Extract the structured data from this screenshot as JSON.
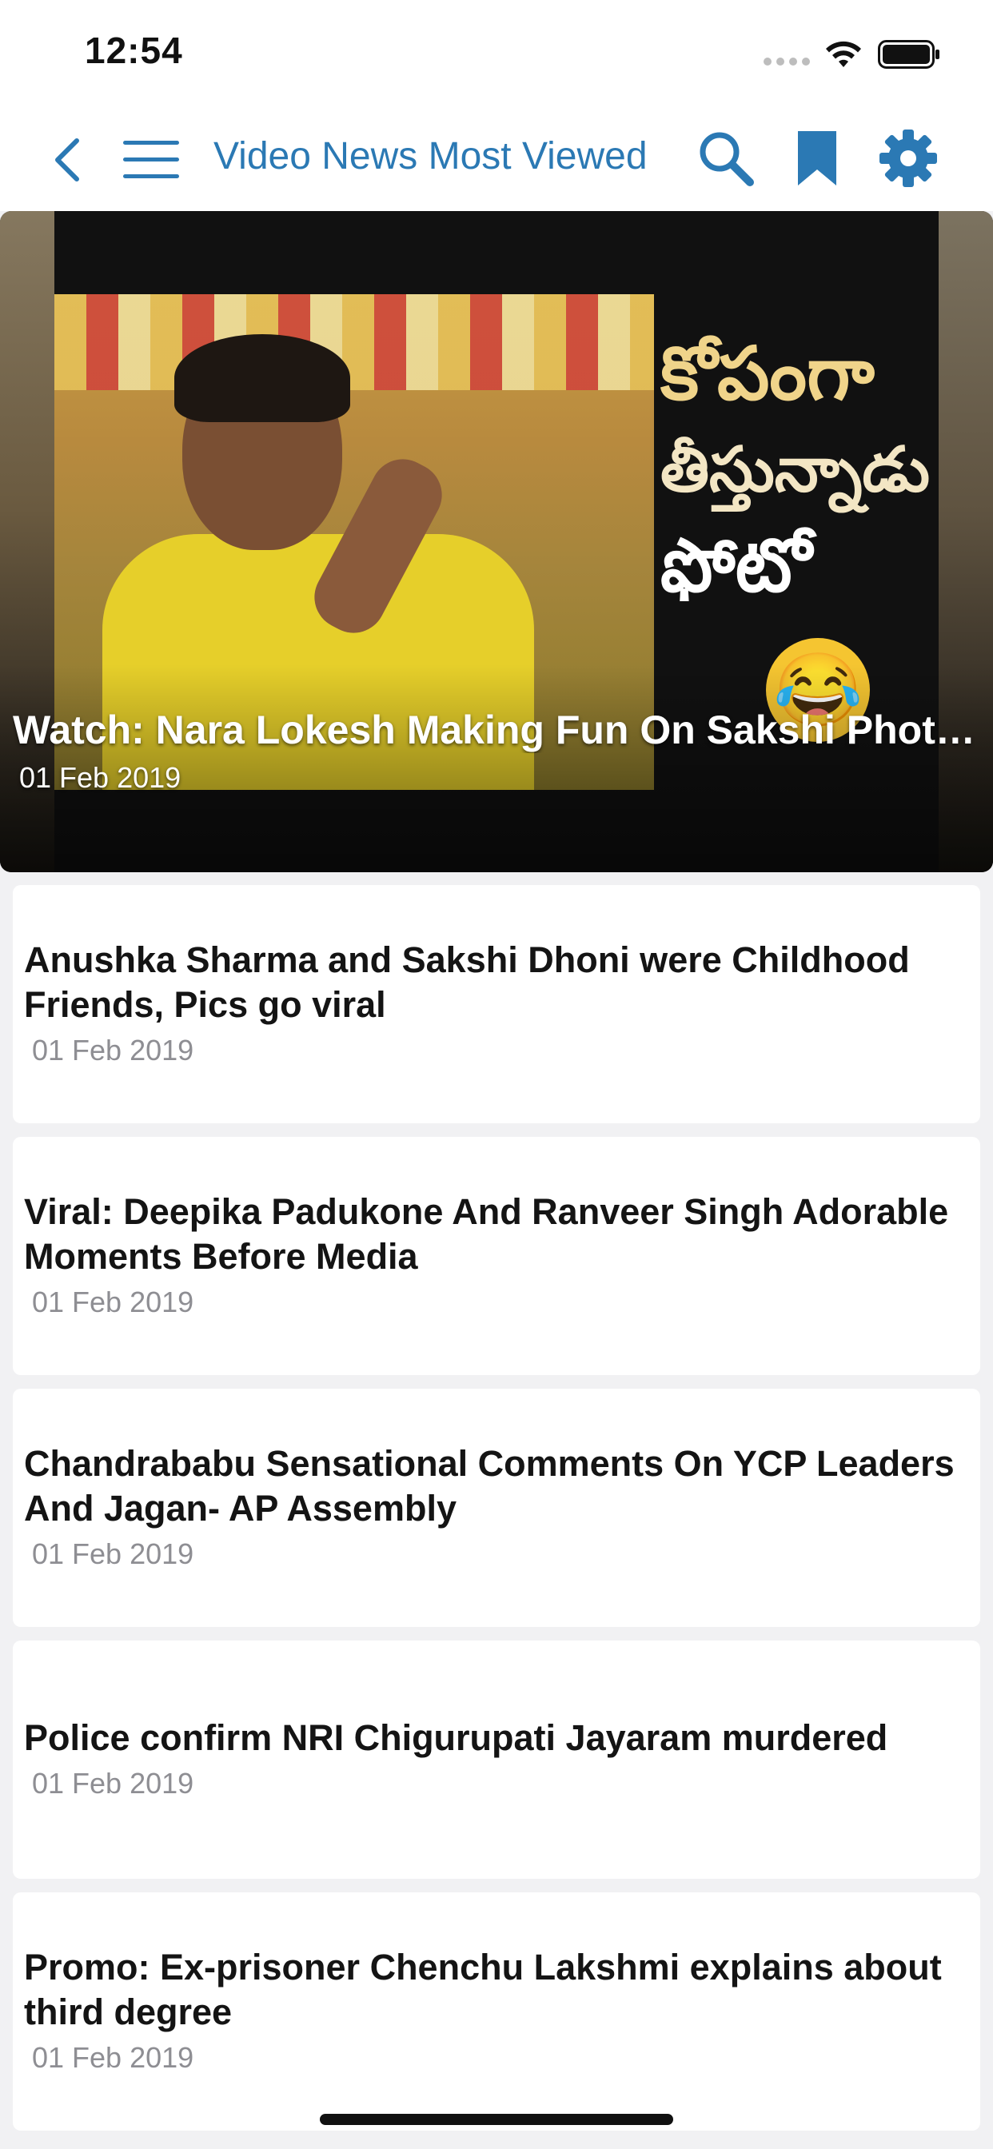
{
  "status_bar": {
    "time": "12:54"
  },
  "nav": {
    "title": "Video News Most Viewed",
    "accent_color": "#2b79b4",
    "icons": [
      "back-chevron-icon",
      "hamburger-menu-icon",
      "search-icon",
      "bookmark-icon",
      "gear-icon"
    ]
  },
  "hero": {
    "title": "Watch: Nara Lokesh Making Fun On Sakshi Phot…",
    "date": "01 Feb 2019",
    "thumbnail_text": [
      "కోపంగా",
      "తీస్తున్నాడు",
      "ఫోటో"
    ]
  },
  "news": [
    {
      "title": "Anushka Sharma and Sakshi Dhoni were Childhood Friends, Pics go viral",
      "date": "01 Feb 2019"
    },
    {
      "title": "Viral: Deepika Padukone And Ranveer Singh Adorable Moments Before Media",
      "date": "01 Feb 2019"
    },
    {
      "title": "Chandrababu Sensational Comments On YCP Leaders And Jagan- AP Assembly",
      "date": "01 Feb 2019"
    },
    {
      "title": "Police confirm NRI Chigurupati Jayaram murdered",
      "date": "01 Feb 2019"
    },
    {
      "title": "Promo: Ex-prisoner Chenchu Lakshmi explains about third degree",
      "date": "01 Feb 2019"
    }
  ]
}
